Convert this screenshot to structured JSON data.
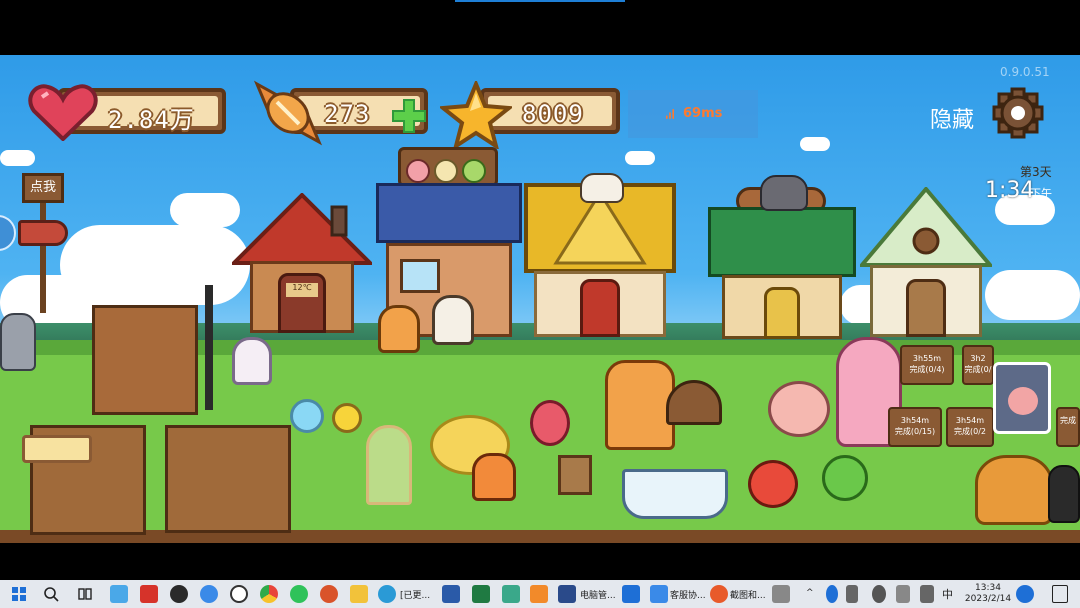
{
  "hud": {
    "hearts": "2.84万",
    "candy": "273",
    "stars": "8009",
    "ping": "69ms",
    "version": "0.9.0.51",
    "hide_label": "隐藏",
    "day": "第3天",
    "time": "1:34",
    "ampm": "下午"
  },
  "sign": {
    "label": "点我"
  },
  "building": {
    "plaque": "12℃"
  },
  "timers": [
    {
      "time": "3h55m",
      "status": "完成(0/4)"
    },
    {
      "time": "3h2",
      "status": "完成(0/"
    },
    {
      "time": "3h54m",
      "status": "完成(0/15)"
    },
    {
      "time": "3h54m",
      "status": "完成(0/2"
    },
    {
      "time": "",
      "status": "完成"
    }
  ],
  "taskbar": {
    "items": [
      {
        "label": "[已更..."
      },
      {
        "label": "电脑管..."
      },
      {
        "label": "客服协..."
      },
      {
        "label": "截图和..."
      }
    ],
    "time": "13:34",
    "date": "2023/2/14",
    "ime": "中"
  },
  "colors": {
    "sky": "#4fb3f2",
    "grass": "#77c94a",
    "hud_wood": "#8a5a34",
    "ping": "#ff7a2f"
  }
}
